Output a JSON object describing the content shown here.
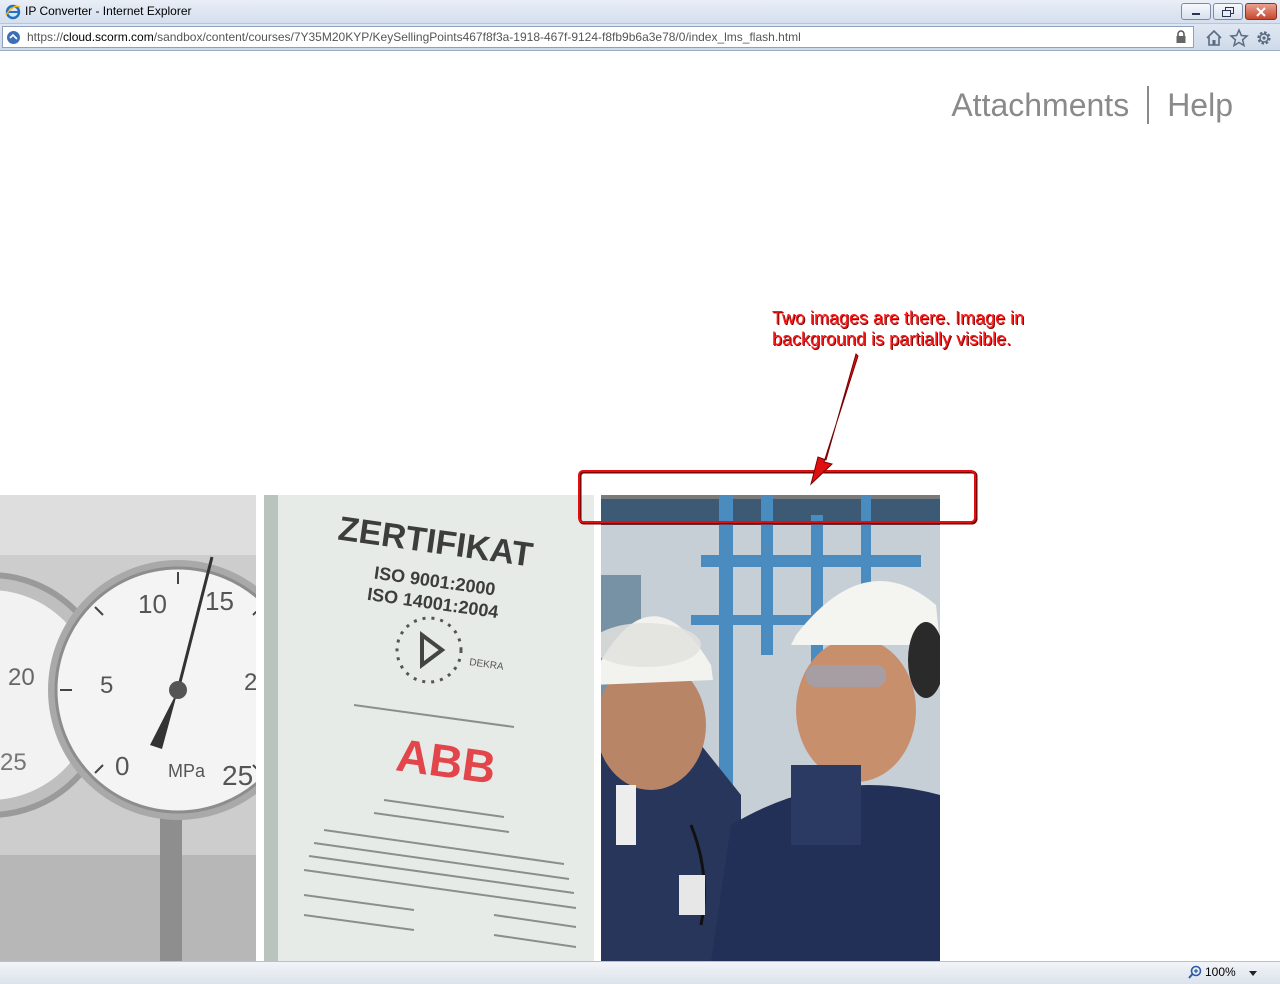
{
  "window": {
    "title": "IP Converter - Internet Explorer"
  },
  "address_bar": {
    "url_prefix": "https://",
    "url_host": "cloud.scorm.com",
    "url_path": "/sandbox/content/courses/7Y35M20KYP/KeySellingPoints467f8f3a-1918-467f-9124-f8fb9b6a3e78/0/index_lms_flash.html"
  },
  "nav": {
    "attachments_label": "Attachments",
    "separator": "|",
    "help_label": "Help"
  },
  "annotation": {
    "line1": "Two images are there. Image in",
    "line2": "background is partially visible.",
    "color": "#e01010"
  },
  "images": {
    "gauge": {
      "tick_10": "10",
      "tick_15": "15",
      "tick_20": "20",
      "tick_5": "5",
      "tick_0": "0",
      "tick_25": "25",
      "tick_25_left": "25",
      "tick_2": "2",
      "unit": "MPa"
    },
    "certificate": {
      "heading": "ZERTIFIKAT",
      "iso1": "ISO 9001:2000",
      "iso2": "ISO 14001:2004",
      "certifier": "DEKRA",
      "brand": "ABB"
    }
  },
  "statusbar": {
    "zoom": "100%"
  }
}
